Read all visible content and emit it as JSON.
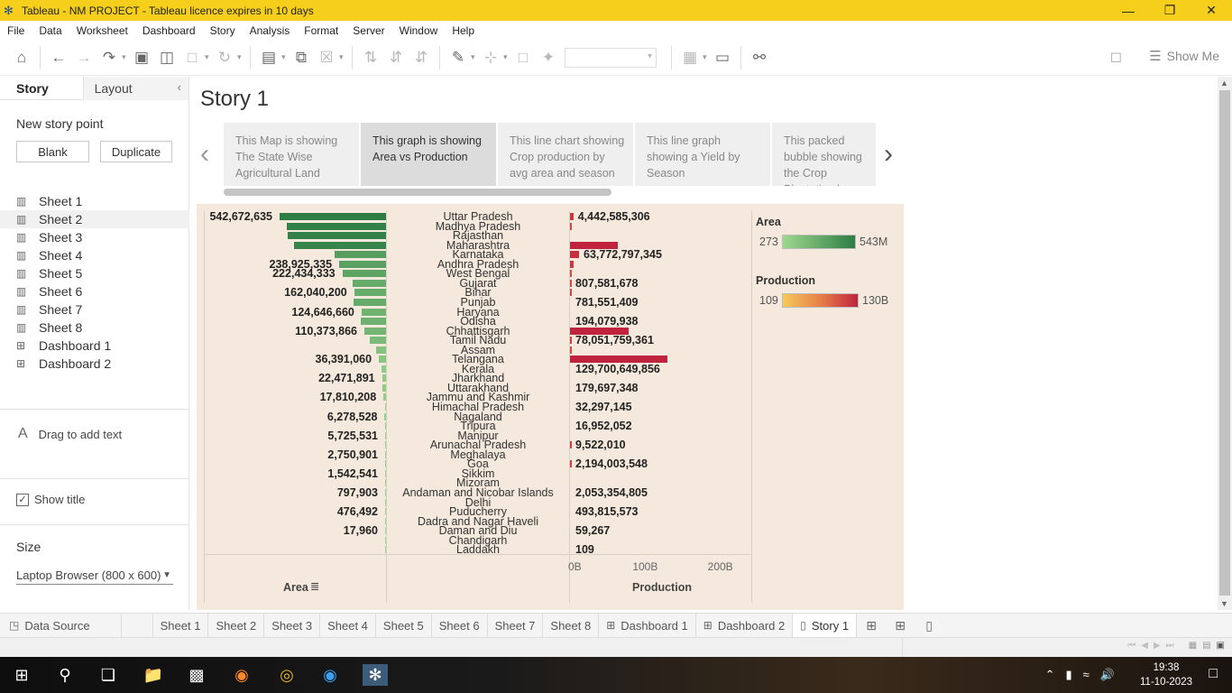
{
  "titlebar": {
    "title": "Tableau - NM PROJECT - Tableau licence expires in 10 days"
  },
  "menu": [
    "File",
    "Data",
    "Worksheet",
    "Dashboard",
    "Story",
    "Analysis",
    "Format",
    "Server",
    "Window",
    "Help"
  ],
  "toolbar": {
    "show_me": "Show Me"
  },
  "left_panel": {
    "tabs": [
      "Story",
      "Layout"
    ],
    "new_story_point": "New story point",
    "blank": "Blank",
    "duplicate": "Duplicate",
    "items": [
      {
        "label": "Sheet 1",
        "type": "sheet"
      },
      {
        "label": "Sheet 2",
        "type": "sheet"
      },
      {
        "label": "Sheet 3",
        "type": "sheet"
      },
      {
        "label": "Sheet 4",
        "type": "sheet"
      },
      {
        "label": "Sheet 5",
        "type": "sheet"
      },
      {
        "label": "Sheet 6",
        "type": "sheet"
      },
      {
        "label": "Sheet 7",
        "type": "sheet"
      },
      {
        "label": "Sheet 8",
        "type": "sheet"
      },
      {
        "label": "Dashboard 1",
        "type": "dashboard"
      },
      {
        "label": "Dashboard 2",
        "type": "dashboard"
      }
    ],
    "drag_text": "Drag to add text",
    "show_title": "Show title",
    "size_heading": "Size",
    "size_value": "Laptop Browser (800 x 600)"
  },
  "story": {
    "title": "Story 1",
    "points": [
      "This Map is showing The State Wise Agricultural Land",
      "This graph is showing Area vs Production",
      "This line chart showing Crop production by avg area and season",
      "This line graph showing a Yield by Season",
      "This packed bubble showing the  Crop Plantation by Area"
    ],
    "active_point": 1
  },
  "chart_data": {
    "type": "bar",
    "categories": [
      "Uttar Pradesh",
      "Madhya Pradesh",
      "Rajasthan",
      "Maharashtra",
      "Karnataka",
      "Andhra Pradesh",
      "West Bengal",
      "Gujarat",
      "Bihar",
      "Punjab",
      "Haryana",
      "Odisha",
      "Chhattisgarh",
      "Tamil Nadu",
      "Assam",
      "Telangana",
      "Kerala",
      "Jharkhand",
      "Uttarakhand",
      "Jammu and Kashmir",
      "Himachal Pradesh",
      "Nagaland",
      "Tripura",
      "Manipur",
      "Arunachal Pradesh",
      "Meghalaya",
      "Goa",
      "Sikkim",
      "Mizoram",
      "Andaman and Nicobar Islands",
      "Delhi",
      "Puducherry",
      "Dadra and Nagar Haveli",
      "Daman and Diu",
      "Chandigarh",
      "Laddakh"
    ],
    "series": [
      {
        "name": "Area",
        "values": [
          542672635,
          505000000,
          500000000,
          470000000,
          262000000,
          238925335,
          222434333,
          170000000,
          162040200,
          167000000,
          124646660,
          130000000,
          110373866,
          85000000,
          50000000,
          36391060,
          22471891,
          20000000,
          17810208,
          13000000,
          6278528,
          7000000,
          5725531,
          3500000,
          2750901,
          2500000,
          1542541,
          1200000,
          797903,
          600000,
          476492,
          350000,
          17960,
          150000,
          100000,
          273
        ]
      },
      {
        "name": "Production",
        "values": [
          4442585306,
          1000000000,
          500000000,
          63772797345,
          12000000000,
          4500000000,
          807581678,
          600000000,
          781551409,
          500000000,
          194079938,
          300000000,
          78051759361,
          1500000000,
          800000000,
          129700649856,
          179697348,
          100000000,
          32297145,
          50000000,
          16952052,
          20000000,
          9522010,
          15000000,
          2194003548,
          10000000,
          2053354805,
          5000000,
          493815573,
          4000000,
          59267,
          3000000,
          109,
          100000,
          50000,
          109
        ]
      }
    ],
    "area_labels": [
      {
        "row": 0,
        "text": "542,672,635"
      },
      {
        "row": 5,
        "text": "238,925,335"
      },
      {
        "row": 6,
        "text": "222,434,333"
      },
      {
        "row": 8,
        "text": "162,040,200"
      },
      {
        "row": 10,
        "text": "124,646,660"
      },
      {
        "row": 12,
        "text": "110,373,866"
      },
      {
        "row": 15,
        "text": "36,391,060"
      },
      {
        "row": 17,
        "text": "22,471,891"
      },
      {
        "row": 19,
        "text": "17,810,208"
      },
      {
        "row": 21,
        "text": "6,278,528"
      },
      {
        "row": 23,
        "text": "5,725,531"
      },
      {
        "row": 25,
        "text": "2,750,901"
      },
      {
        "row": 27,
        "text": "1,542,541"
      },
      {
        "row": 29,
        "text": "797,903"
      },
      {
        "row": 31,
        "text": "476,492"
      },
      {
        "row": 33,
        "text": "17,960"
      }
    ],
    "production_labels": [
      {
        "row": 0,
        "text": "4,442,585,306"
      },
      {
        "row": 4,
        "text": "63,772,797,345"
      },
      {
        "row": 7,
        "text": "807,581,678"
      },
      {
        "row": 9,
        "text": "781,551,409"
      },
      {
        "row": 11,
        "text": "194,079,938"
      },
      {
        "row": 13,
        "text": "78,051,759,361"
      },
      {
        "row": 16,
        "text": "129,700,649,856"
      },
      {
        "row": 18,
        "text": "179,697,348"
      },
      {
        "row": 20,
        "text": "32,297,145"
      },
      {
        "row": 22,
        "text": "16,952,052"
      },
      {
        "row": 24,
        "text": "9,522,010"
      },
      {
        "row": 26,
        "text": "2,194,003,548"
      },
      {
        "row": 29,
        "text": "2,053,354,805"
      },
      {
        "row": 31,
        "text": "493,815,573"
      },
      {
        "row": 33,
        "text": "59,267"
      },
      {
        "row": 35,
        "text": "109"
      }
    ],
    "production_ticks": [
      "0B",
      "100B",
      "200B"
    ],
    "production_xlim": [
      0,
      240000000000
    ],
    "xlabel_area": "Area",
    "xlabel_production": "Production",
    "legend_area": {
      "title": "Area",
      "min": "273",
      "max": "543M",
      "colors": [
        "#9fd88f",
        "#2e7d45"
      ]
    },
    "legend_production": {
      "title": "Production",
      "min": "109",
      "max": "130B",
      "colors": [
        "#f6c95a",
        "#e8804a",
        "#c0233e"
      ]
    }
  },
  "sheet_tabs": {
    "data_source": "Data Source",
    "tabs": [
      {
        "label": "Sheet 1",
        "type": "sheet"
      },
      {
        "label": "Sheet 2",
        "type": "sheet"
      },
      {
        "label": "Sheet 3",
        "type": "sheet"
      },
      {
        "label": "Sheet 4",
        "type": "sheet"
      },
      {
        "label": "Sheet 5",
        "type": "sheet"
      },
      {
        "label": "Sheet 6",
        "type": "sheet"
      },
      {
        "label": "Sheet 7",
        "type": "sheet"
      },
      {
        "label": "Sheet 8",
        "type": "sheet"
      },
      {
        "label": "Dashboard 1",
        "type": "dashboard"
      },
      {
        "label": "Dashboard 2",
        "type": "dashboard"
      },
      {
        "label": "Story 1",
        "type": "story"
      }
    ],
    "active": "Story 1"
  },
  "taskbar": {
    "time": "19:38",
    "date": "11-10-2023"
  }
}
